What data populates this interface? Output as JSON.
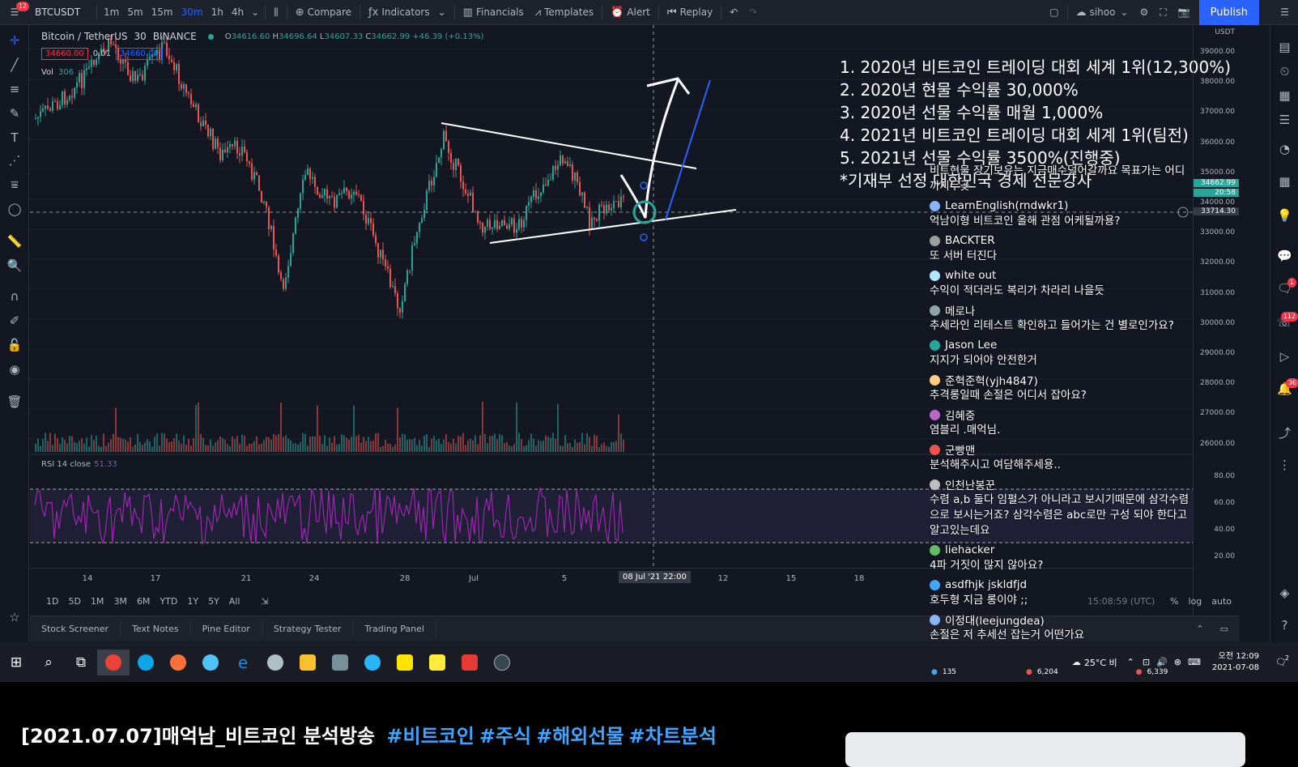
{
  "toolbar": {
    "symbol": "BTCUSDT",
    "intervals": [
      "1m",
      "5m",
      "15m",
      "30m",
      "1h",
      "4h"
    ],
    "active_interval": "30m",
    "compare": "Compare",
    "indicators": "Indicators",
    "financials": "Financials",
    "templates": "Templates",
    "alert": "Alert",
    "replay": "Replay",
    "user": "sihoo",
    "publish": "Publish",
    "notification_count": "12"
  },
  "legend": {
    "title": "Bitcoin / TetherUS",
    "interval": "30",
    "exchange": "BINANCE",
    "open": "34616.60",
    "high": "34696.64",
    "low": "34607.33",
    "close": "34662.99",
    "change": "+46.39 (+0.13%)",
    "sell_price": "34660.00",
    "spread": "0.01",
    "buy_price": "34660.01",
    "vol_label": "Vol",
    "vol_value": "306",
    "rsi_label": "RSI 14 close",
    "rsi_value": "51.33"
  },
  "overlay_text": [
    "1. 2020년 비트코인 트레이딩 대회 세계 1위(12,300%)",
    "2. 2020년 현물 수익률 30,000%",
    "3. 2020년 선물 수익률 매월 1,000%",
    "4. 2021년 비트코인 트레이딩 대회 세계 1위(팀전)",
    "5. 2021년 선물 수익률 3500%(진행중)",
    "*기재부 선정 대한민국 경제 전문강사"
  ],
  "price_axis": {
    "currency": "USDT",
    "labels": [
      "39000.00",
      "38000.00",
      "37000.00",
      "36000.00",
      "35000.00",
      "34000.00",
      "33000.00",
      "32000.00",
      "31000.00",
      "30000.00",
      "29000.00",
      "28000.00",
      "27000.00",
      "26000.00"
    ],
    "current_price": "34662.99",
    "countdown": "20:58",
    "crosshair_price": "33714.30",
    "rsi_labels": [
      "80.00",
      "60.00",
      "40.00",
      "20.00"
    ]
  },
  "time_axis": {
    "labels": [
      "14",
      "17",
      "21",
      "24",
      "28",
      "Jul",
      "5",
      "12",
      "15",
      "18"
    ],
    "crosshair_date": "08 Jul '21",
    "crosshair_time": "22:00"
  },
  "range_bar": {
    "ranges": [
      "1D",
      "5D",
      "1M",
      "3M",
      "6M",
      "YTD",
      "1Y",
      "5Y",
      "All"
    ],
    "clock": "15:08:59 (UTC)",
    "percent": "%",
    "log": "log",
    "auto": "auto"
  },
  "panel_tabs": [
    "Stock Screener",
    "Text Notes",
    "Pine Editor",
    "Strategy Tester",
    "Trading Panel"
  ],
  "chat": [
    {
      "user": "",
      "message": "비트현물 장기보유는 지금매수덜어갈까요 목표가는 어디까지두곶",
      "color": "#cccccc"
    },
    {
      "user": "LearnEnglish(rndwkr1)",
      "message": "억남이형 비트코인 올해 관점 어케될까용?",
      "color": "#8ab4f8"
    },
    {
      "user": "BACKTER",
      "message": "또 서버 터진다",
      "color": "#9e9e9e"
    },
    {
      "user": "white out",
      "message": "수익이 적더라도 복리가 차라리 나을듯",
      "color": "#b3e5fc"
    },
    {
      "user": "메로나",
      "message": "추세라인 리테스트 확인하고 들어가는 건 별로인가요?",
      "color": "#90a4ae"
    },
    {
      "user": "Jason Lee",
      "message": "지지가 되어야 안전한거",
      "color": "#26a69a"
    },
    {
      "user": "준혁준혁(yjh4847)",
      "message": "추격롱일때 손절은 어디서 잡아요?",
      "color": "#ffcc80"
    },
    {
      "user": "김혜중",
      "message": "염블리 .매억님.",
      "color": "#ba68c8"
    },
    {
      "user": "군빵맨",
      "message": "분석해주시고 여담해주세용..",
      "color": "#ef5350"
    },
    {
      "user": "인천난봉꾼",
      "message": "수렴 a,b 둘다 임펄스가 아니라고 보시기때문에 삼각수렴으로 보시는거죠? 삼각수렴은 abc로만 구성 되야 한다고 알고있는데요",
      "color": "#bdbdbd"
    },
    {
      "user": "liehacker",
      "message": "4파 거짓이 많지 않아요?",
      "color": "#66bb6a"
    },
    {
      "user": "asdfhjk jskldfjd",
      "message": "호두형 지금 롱이야 ;;",
      "color": "#42a5f5"
    },
    {
      "user": "이정대(leejungdea)",
      "message": "손절은 저 추세선 잡는거 어떤가요",
      "color": "#8ab4f8"
    }
  ],
  "right_badges": {
    "chat": "1",
    "alerts": "112",
    "ideas": "36"
  },
  "taskbar": {
    "weather": "25°C 비",
    "viewers": "135",
    "likes": "6,204",
    "subs": "6,339",
    "ampm": "오전 12:09",
    "date": "2021-07-08",
    "notif": "2"
  },
  "video": {
    "title": "[2021.07.07]매억남_비트코인 분석방송",
    "tags": [
      "#비트코인",
      "#주식",
      "#해외선물",
      "#차트분석"
    ]
  },
  "colors": {
    "up": "#26a69a",
    "down": "#ef5350",
    "rsi": "#9c27b0",
    "accent": "#2962ff"
  }
}
